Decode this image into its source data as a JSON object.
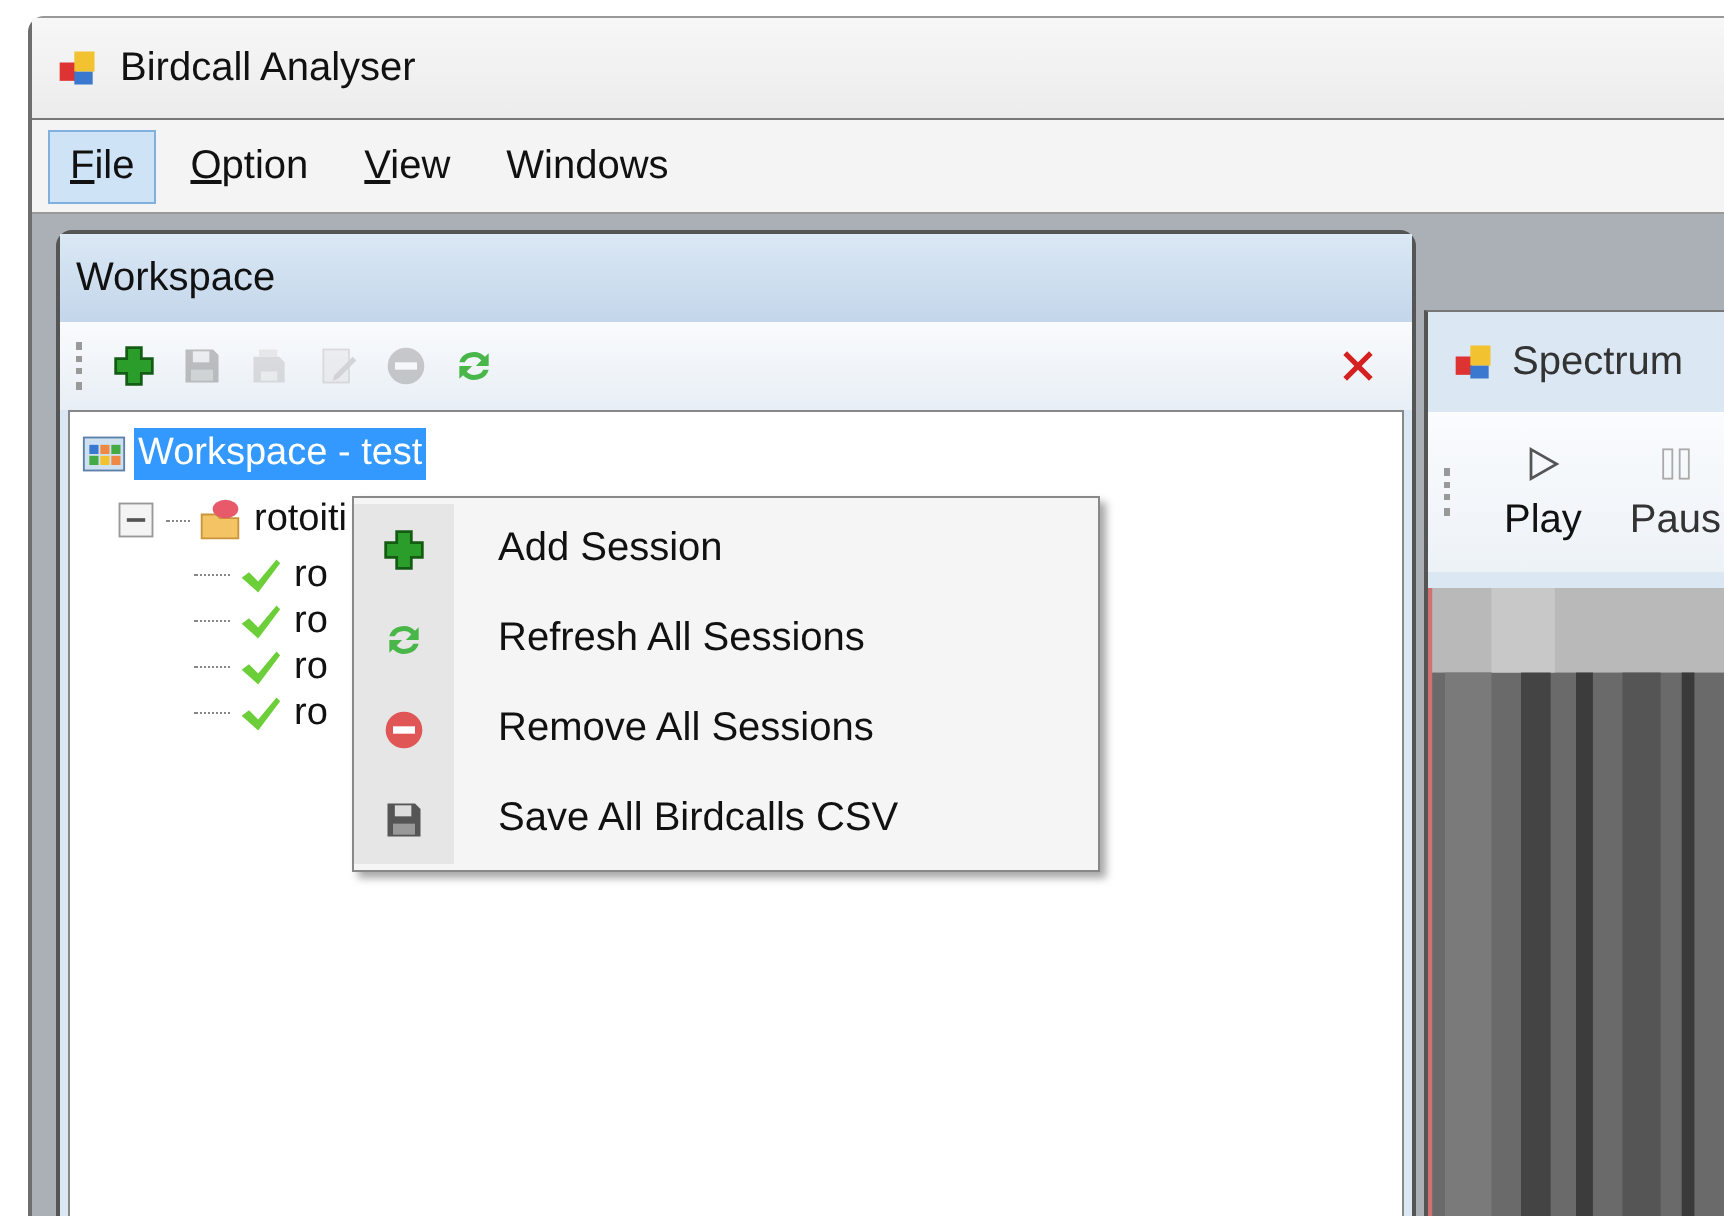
{
  "window": {
    "title": "Birdcall Analyser"
  },
  "menu": [
    {
      "label": "File",
      "mnemonic": true,
      "selected": true
    },
    {
      "label": "Option",
      "mnemonic": true,
      "selected": false
    },
    {
      "label": "View",
      "mnemonic": true,
      "selected": false
    },
    {
      "label": "Windows",
      "mnemonic": false,
      "selected": false
    }
  ],
  "workspace": {
    "title": "Workspace",
    "toolbar": [
      {
        "kind": "add",
        "disabled": false
      },
      {
        "kind": "save",
        "disabled": true
      },
      {
        "kind": "save-as",
        "disabled": true
      },
      {
        "kind": "edit",
        "disabled": true
      },
      {
        "kind": "remove",
        "disabled": true
      },
      {
        "kind": "refresh",
        "disabled": false
      }
    ],
    "tree": {
      "label": "Workspace - test",
      "selected": true,
      "children": [
        {
          "label": "rotoiti",
          "kind": "session",
          "expanded": true,
          "children": [
            {
              "label": "ro",
              "kind": "done"
            },
            {
              "label": "ro",
              "kind": "done"
            },
            {
              "label": "ro",
              "kind": "done"
            },
            {
              "label": "ro",
              "kind": "done"
            }
          ]
        }
      ]
    }
  },
  "context_menu": [
    {
      "label": "Add Session",
      "kind": "add"
    },
    {
      "label": "Refresh All Sessions",
      "kind": "refresh"
    },
    {
      "label": "Remove All Sessions",
      "kind": "remove"
    },
    {
      "label": "Save All Birdcalls CSV",
      "kind": "save"
    }
  ],
  "spectrum": {
    "title": "Spectrum",
    "toolbar": [
      {
        "label": "Play",
        "kind": "play",
        "disabled": false
      },
      {
        "label": "Paus",
        "kind": "pause",
        "disabled": true
      }
    ]
  }
}
